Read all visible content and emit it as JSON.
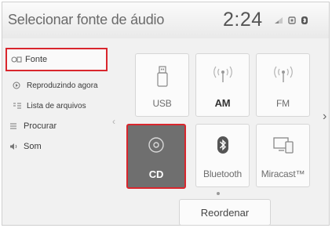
{
  "header": {
    "title": "Selecionar fonte de áudio",
    "clock": "2:24",
    "status_icons": [
      "signal-icon",
      "battery-icon",
      "bluetooth-icon"
    ]
  },
  "sidebar": {
    "items": [
      {
        "label": "Fonte",
        "icon": "source-icon",
        "selected": true
      },
      {
        "label": "Reproduzindo agora",
        "icon": "play-icon",
        "selected": false
      },
      {
        "label": "Lista de arquivos",
        "icon": "list-icon",
        "selected": false
      },
      {
        "label": "Procurar",
        "icon": "search-list-icon",
        "selected": false
      },
      {
        "label": "Som",
        "icon": "speaker-icon",
        "selected": false
      }
    ]
  },
  "sources": [
    {
      "label": "USB",
      "icon": "usb-icon",
      "active": false
    },
    {
      "label": "AM",
      "icon": "am-radio-icon",
      "active": false
    },
    {
      "label": "FM",
      "icon": "fm-radio-icon",
      "active": false
    },
    {
      "label": "CD",
      "icon": "cd-icon",
      "active": true
    },
    {
      "label": "Bluetooth",
      "icon": "bluetooth-icon",
      "active": false
    },
    {
      "label": "Miracast™",
      "icon": "miracast-icon",
      "active": false
    }
  ],
  "reorder_label": "Reordenar",
  "colors": {
    "highlight_border": "#d9262d",
    "active_tile": "#6f6f6f",
    "background": "#f1f1f1"
  }
}
